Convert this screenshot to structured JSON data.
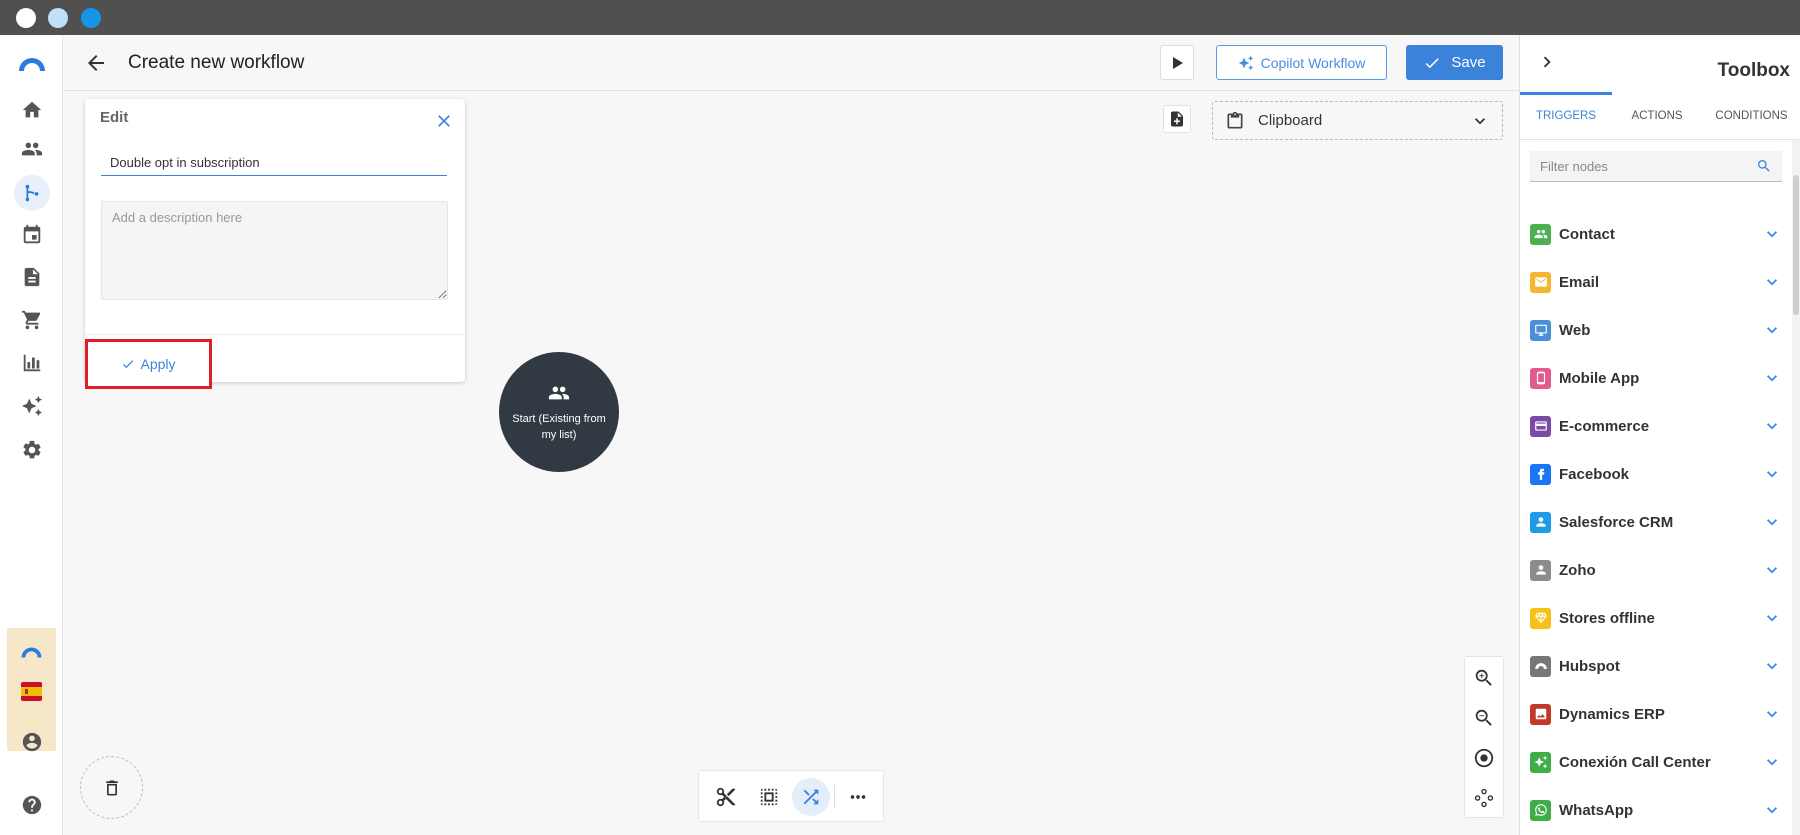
{
  "header": {
    "title": "Create new workflow",
    "copilot_label": "Copilot Workflow",
    "save_label": "Save"
  },
  "clipboard": {
    "label": "Clipboard"
  },
  "edit_panel": {
    "title": "Edit",
    "name_value": "Double opt in subscription",
    "description_placeholder": "Add a description here",
    "apply_label": "Apply"
  },
  "start_node": {
    "label": "Start (Existing from my list)"
  },
  "toolbox": {
    "title": "Toolbox",
    "tabs": [
      {
        "label": "TRIGGERS",
        "active": true
      },
      {
        "label": "ACTIONS",
        "active": false
      },
      {
        "label": "CONDITIONS",
        "active": false
      }
    ],
    "filter_placeholder": "Filter nodes",
    "items": [
      {
        "label": "Contact",
        "color": "#4caf50",
        "icon": "people-icon"
      },
      {
        "label": "Email",
        "color": "#f5b731",
        "icon": "mail-icon"
      },
      {
        "label": "Web",
        "color": "#4a90d9",
        "icon": "monitor-icon"
      },
      {
        "label": "Mobile App",
        "color": "#e05b8e",
        "icon": "phone-icon"
      },
      {
        "label": "E-commerce",
        "color": "#7a4aa5",
        "icon": "card-icon"
      },
      {
        "label": "Facebook",
        "color": "#1877f2",
        "icon": "facebook-icon"
      },
      {
        "label": "Salesforce CRM",
        "color": "#1e9be6",
        "icon": "person-icon"
      },
      {
        "label": "Zoho",
        "color": "#8c8c8c",
        "icon": "person-icon"
      },
      {
        "label": "Stores offline",
        "color": "#f6c21a",
        "icon": "diamond-icon"
      },
      {
        "label": "Hubspot",
        "color": "#777777",
        "icon": "hubspot-icon"
      },
      {
        "label": "Dynamics ERP",
        "color": "#c0392b",
        "icon": "image-icon"
      },
      {
        "label": "Conexión Call Center",
        "color": "#3fae49",
        "icon": "sparkle-icon"
      },
      {
        "label": "WhatsApp",
        "color": "#3fae49",
        "icon": "whatsapp-icon"
      }
    ]
  },
  "accent_color": "#3b82db"
}
